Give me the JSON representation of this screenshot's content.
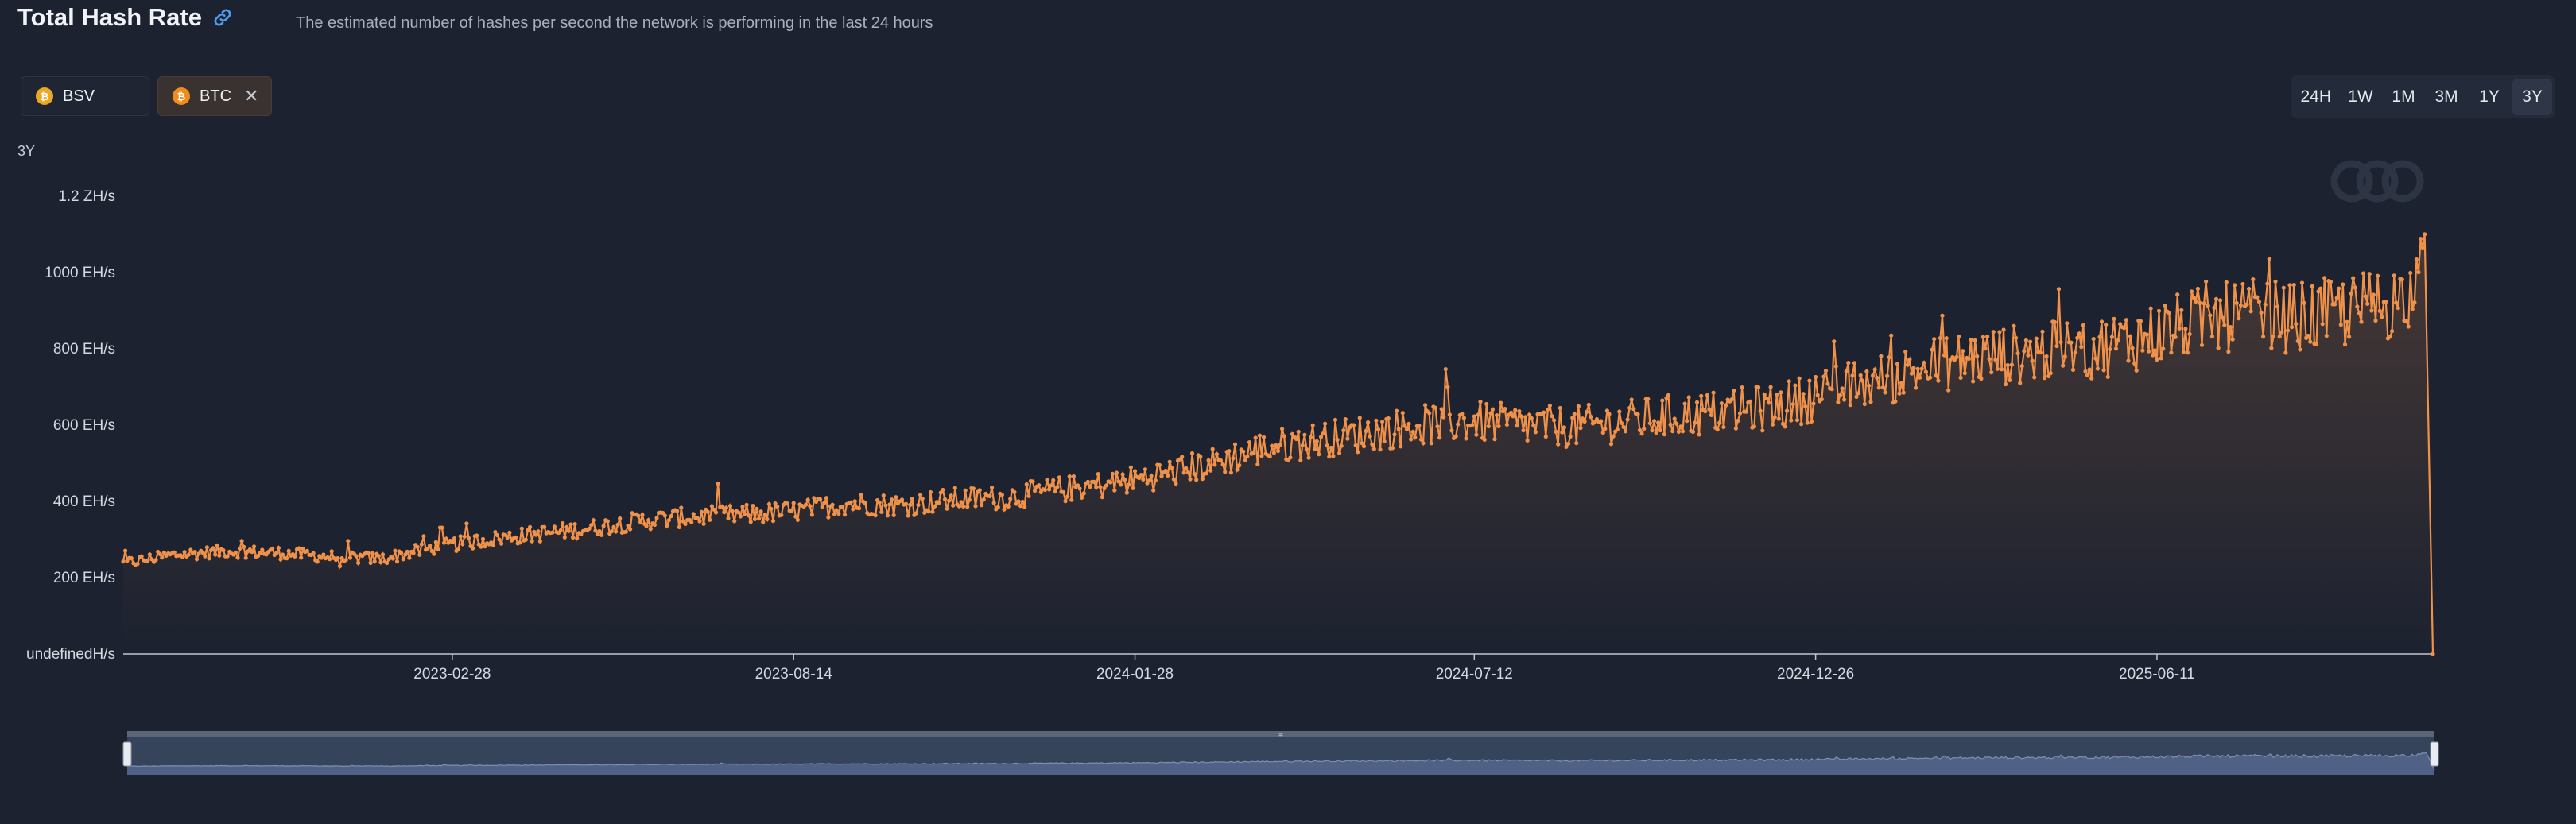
{
  "header": {
    "title": "Total Hash Rate",
    "subtitle": "The estimated number of hashes per second the network is performing in the last 24 hours",
    "link_icon": "link-icon"
  },
  "coins": [
    {
      "label": "BSV",
      "icon_color": "#e9a924",
      "active": false,
      "removable": false
    },
    {
      "label": "BTC",
      "icon_color": "#f08c1a",
      "active": true,
      "removable": true
    }
  ],
  "ranges": {
    "options": [
      "24H",
      "1W",
      "1M",
      "3M",
      "1Y",
      "3Y"
    ],
    "selected": "3Y"
  },
  "range_label": "3Y",
  "colors": {
    "line": "#f0914a",
    "background": "#1c2230",
    "axis": "#c0c5ce",
    "navigator_fill": "#4e6280"
  },
  "chart_data": {
    "type": "area",
    "title": "",
    "xlabel": "",
    "ylabel": "",
    "unit": "EH/s",
    "x_range": [
      "2022-09-20",
      "2025-10-24"
    ],
    "y_range": [
      0,
      1200
    ],
    "y_ticks": [
      {
        "value": 0,
        "label": "undefinedH/s"
      },
      {
        "value": 200,
        "label": "200 EH/s"
      },
      {
        "value": 400,
        "label": "400 EH/s"
      },
      {
        "value": 600,
        "label": "600 EH/s"
      },
      {
        "value": 800,
        "label": "800 EH/s"
      },
      {
        "value": 1000,
        "label": "1000 EH/s"
      },
      {
        "value": 1200,
        "label": "1.2 ZH/s"
      }
    ],
    "x_ticks": [
      "2023-02-28",
      "2023-08-14",
      "2024-01-28",
      "2024-07-12",
      "2024-12-26",
      "2025-06-11"
    ],
    "series": [
      {
        "x": [
          "2022-09-20",
          "2022-10-15",
          "2022-11-10",
          "2022-12-05",
          "2022-12-30",
          "2023-01-25",
          "2023-02-20",
          "2023-03-17",
          "2023-04-11",
          "2023-05-07",
          "2023-06-01",
          "2023-06-26",
          "2023-07-22",
          "2023-08-16",
          "2023-09-10",
          "2023-10-06",
          "2023-10-31",
          "2023-11-25",
          "2023-12-21",
          "2024-01-15",
          "2024-02-09",
          "2024-03-06",
          "2024-03-31",
          "2024-04-25",
          "2024-05-21",
          "2024-06-15",
          "2024-07-10",
          "2024-08-04",
          "2024-08-30",
          "2024-09-24",
          "2024-10-19",
          "2024-11-14",
          "2024-12-09",
          "2025-01-03",
          "2025-01-29",
          "2025-02-23",
          "2025-03-20",
          "2025-04-15",
          "2025-05-10",
          "2025-06-04",
          "2025-06-30",
          "2025-07-25",
          "2025-08-19",
          "2025-09-14",
          "2025-10-09",
          "2025-10-20",
          "2025-10-24"
        ],
        "values": [
          238,
          260,
          270,
          265,
          255,
          250,
          280,
          300,
          315,
          330,
          350,
          360,
          365,
          375,
          395,
          390,
          405,
          410,
          430,
          445,
          470,
          500,
          540,
          560,
          580,
          600,
          610,
          600,
          595,
          610,
          625,
          635,
          650,
          690,
          720,
          760,
          780,
          790,
          800,
          830,
          870,
          890,
          880,
          900,
          930,
          1000,
          0
        ]
      }
    ]
  },
  "navigator": {
    "handle_icon": "grip-icon"
  }
}
